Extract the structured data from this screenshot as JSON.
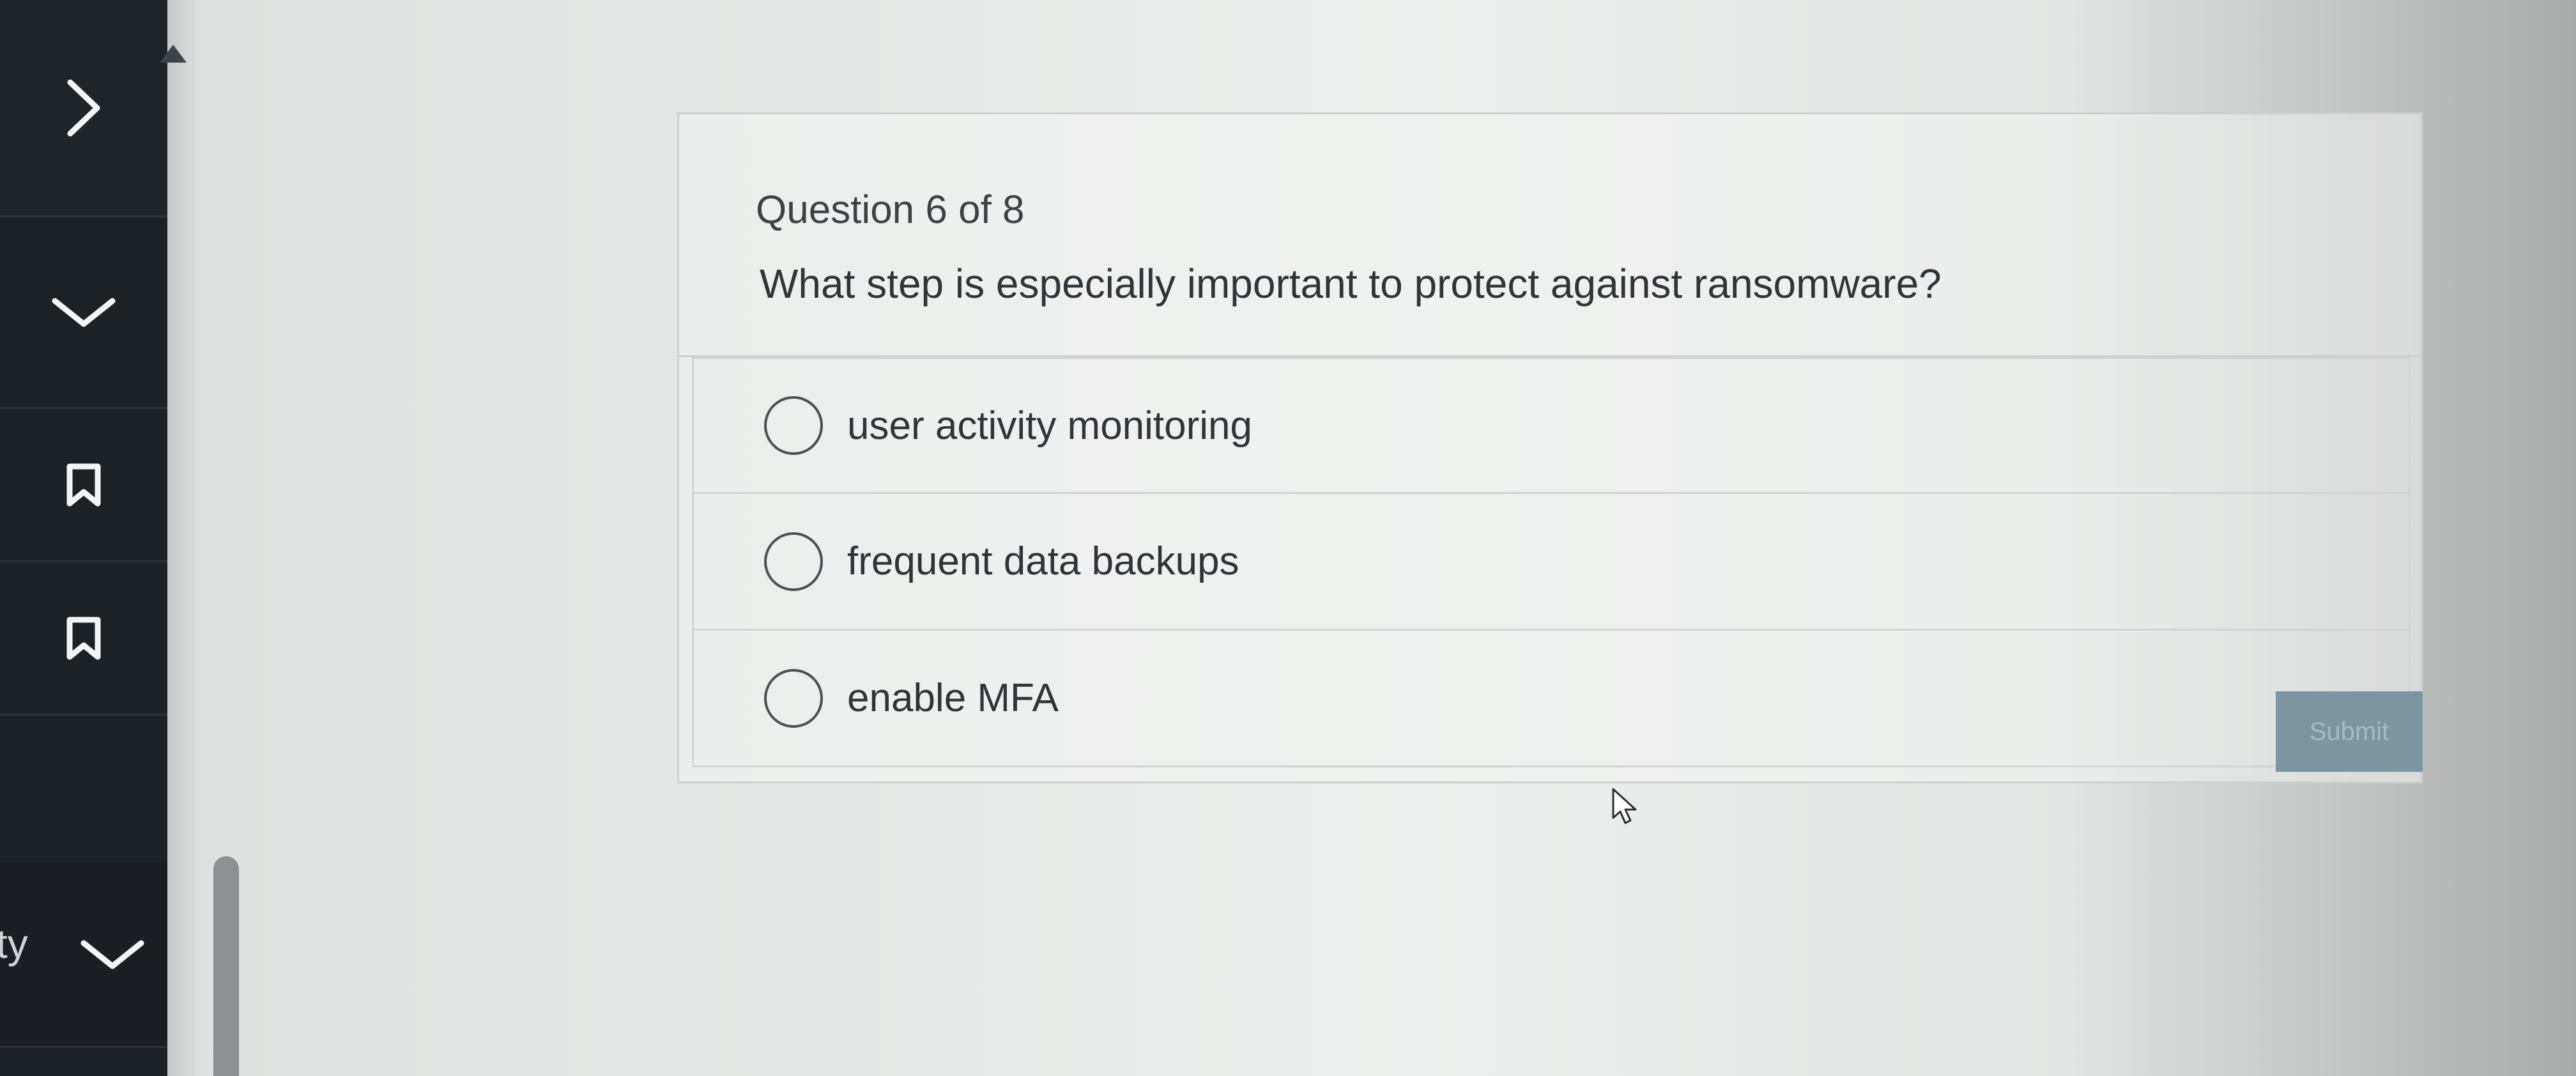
{
  "sidebar": {
    "label_fragment": "ty",
    "icons": [
      "chevron-right-icon",
      "chevron-down-icon",
      "bookmark-icon",
      "bookmark-icon",
      "chevron-down-icon"
    ]
  },
  "question": {
    "counter": "Question 6 of 8",
    "text": "What step is especially important to protect against ransomware?"
  },
  "options": [
    {
      "label": "user activity monitoring",
      "selected": false
    },
    {
      "label": "frequent data backups",
      "selected": false
    },
    {
      "label": "enable MFA",
      "selected": false
    }
  ],
  "submit_label": "Submit",
  "colors": {
    "sidebar_bg": "#1c2125",
    "submit_bg": "#7b96a0",
    "text": "#2f3538"
  }
}
